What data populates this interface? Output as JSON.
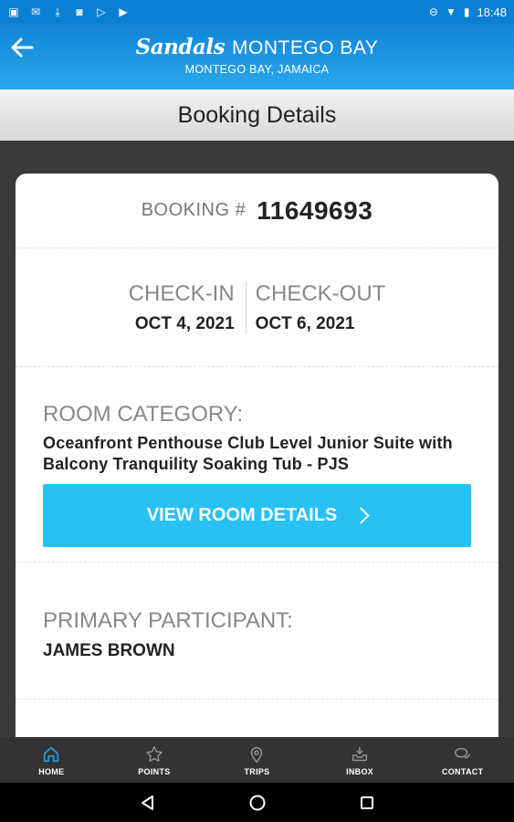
{
  "status_bar": {
    "time": "18:48",
    "left_icons": [
      "image-icon",
      "mail-icon",
      "download-icon",
      "camera-icon",
      "play-store-icon",
      "play-icon"
    ],
    "right_icons": [
      "dnd-icon",
      "wifi-icon",
      "battery-icon"
    ]
  },
  "header": {
    "brand_logo": "Sandals",
    "resort_name": "MONTEGO BAY",
    "location": "MONTEGO BAY, JAMAICA"
  },
  "page_title": "Booking Details",
  "booking": {
    "label": "BOOKING #",
    "number": "11649693"
  },
  "dates": {
    "checkin_label": "CHECK-IN",
    "checkin_value": "OCT 4, 2021",
    "checkout_label": "CHECK-OUT",
    "checkout_value": "OCT 6, 2021"
  },
  "room": {
    "label": "ROOM CATEGORY:",
    "value": "Oceanfront Penthouse Club Level Junior Suite with Balcony Tranquility Soaking Tub - PJS",
    "button_label": "VIEW ROOM DETAILS"
  },
  "participant": {
    "label": "PRIMARY PARTICIPANT:",
    "value": "JAMES BROWN"
  },
  "bottom_nav": [
    {
      "label": "HOME",
      "icon": "home-icon",
      "active": true
    },
    {
      "label": "POINTS",
      "icon": "star-icon",
      "active": false
    },
    {
      "label": "TRIPS",
      "icon": "map-pin-icon",
      "active": false
    },
    {
      "label": "INBOX",
      "icon": "inbox-icon",
      "active": false
    },
    {
      "label": "CONTACT",
      "icon": "chat-icon",
      "active": false
    }
  ],
  "colors": {
    "header_blue": "#1184d6",
    "button_blue": "#29c0f5",
    "active_nav": "#1ea2ec"
  }
}
